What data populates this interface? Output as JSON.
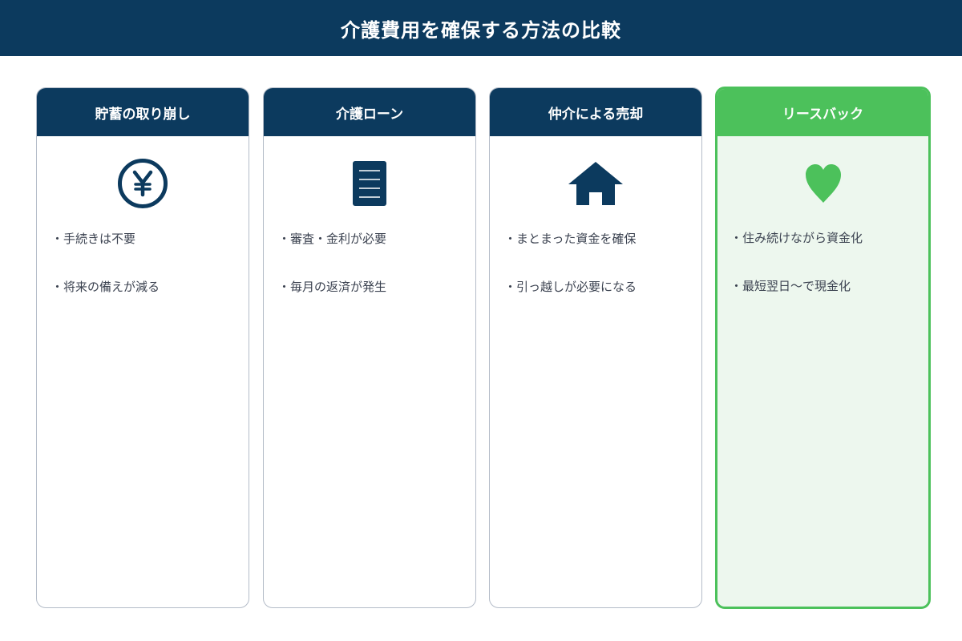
{
  "title": "介護費用を確保する方法の比較",
  "colors": {
    "navy": "#0c3a5e",
    "green": "#4cc15b",
    "green_bg": "#edf7ee",
    "border": "#b4bcc8"
  },
  "cards": [
    {
      "title": "貯蓄の取り崩し",
      "icon": "yen-circle-icon",
      "points": [
        "・手続きは不要",
        "・将来の備えが減る"
      ]
    },
    {
      "title": "介護ローン",
      "icon": "document-icon",
      "points": [
        "・審査・金利が必要",
        "・毎月の返済が発生"
      ]
    },
    {
      "title": "仲介による売却",
      "icon": "house-icon",
      "points": [
        "・まとまった資金を確保",
        "・引っ越しが必要になる"
      ]
    },
    {
      "title": "リースバック",
      "icon": "heart-icon",
      "highlighted": true,
      "points": [
        "・住み続けながら資金化",
        "・最短翌日〜で現金化"
      ]
    }
  ]
}
